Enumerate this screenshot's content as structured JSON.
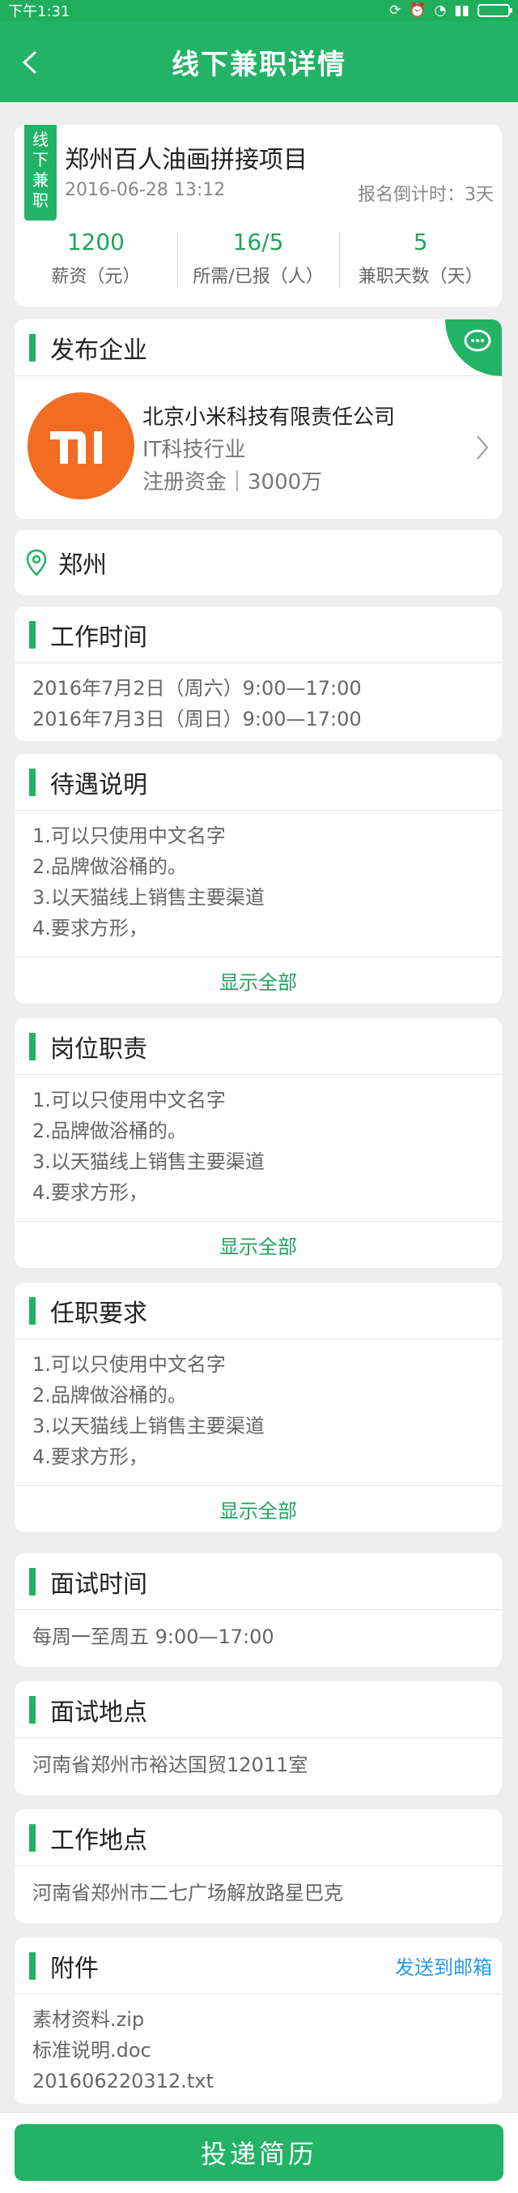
{
  "status_bar": {
    "time": "下午1:31"
  },
  "nav": {
    "title": "线下兼职详情"
  },
  "job": {
    "tag": [
      "线",
      "下",
      "兼",
      "职"
    ],
    "title": "郑州百人油画拼接项目",
    "date": "2016-06-28 13:12",
    "countdown": "报名倒计时：3天",
    "stats": [
      {
        "value": "1200",
        "label": "薪资（元）"
      },
      {
        "value": "16/5",
        "label": "所需/已报（人）"
      },
      {
        "value": "5",
        "label": "兼职天数（天）"
      }
    ]
  },
  "company": {
    "section_title": "发布企业",
    "name": "北京小米科技有限责任公司",
    "industry": "IT科技行业",
    "capital": "注册资金｜3000万"
  },
  "location": {
    "city": "郑州"
  },
  "work_time": {
    "title": "工作时间",
    "lines": [
      "2016年7月2日（周六）9:00—17:00",
      "2016年7月3日（周日）9:00—17:00"
    ]
  },
  "benefits": {
    "title": "待遇说明",
    "lines": [
      "1.可以只使用中文名字",
      "2.品牌做浴桶的。",
      "3.以天猫线上销售主要渠道",
      "4.要求方形，"
    ],
    "show_all": "显示全部"
  },
  "duties": {
    "title": "岗位职责",
    "lines": [
      "1.可以只使用中文名字",
      "2.品牌做浴桶的。",
      "3.以天猫线上销售主要渠道",
      "4.要求方形，"
    ],
    "show_all": "显示全部"
  },
  "requirements": {
    "title": "任职要求",
    "lines": [
      "1.可以只使用中文名字",
      "2.品牌做浴桶的。",
      "3.以天猫线上销售主要渠道",
      "4.要求方形，"
    ],
    "show_all": "显示全部"
  },
  "interview_time": {
    "title": "面试时间",
    "text": "每周一至周五 9:00—17:00"
  },
  "interview_place": {
    "title": "面试地点",
    "text": "河南省郑州市裕达国贸12011室"
  },
  "work_place": {
    "title": "工作地点",
    "text": "河南省郑州市二七广场解放路星巴克"
  },
  "attachments": {
    "title": "附件",
    "link": "发送到邮箱",
    "files": [
      "素材资料.zip",
      "标准说明.doc",
      "201606220312.txt"
    ]
  },
  "submit": {
    "label": "投递简历"
  },
  "colors": {
    "primary": "#22b366",
    "accent_text": "#22a35e",
    "link": "#2a9ae0",
    "logo": "#f26c22"
  }
}
